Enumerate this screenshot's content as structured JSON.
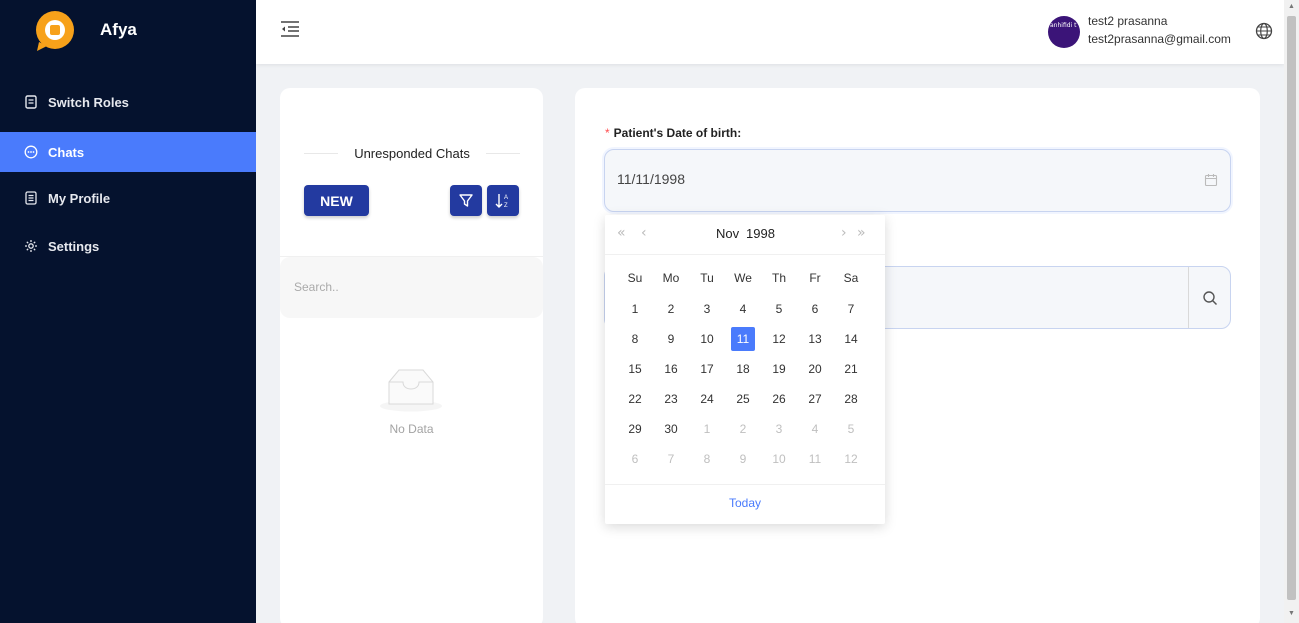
{
  "brand": {
    "name": "Afya",
    "color": "#f7a11a"
  },
  "sidebar": {
    "items": [
      {
        "label": "Switch Roles",
        "icon": "switch-roles-icon",
        "active": false
      },
      {
        "label": "Chats",
        "icon": "chat-bubble-icon",
        "active": true
      },
      {
        "label": "My Profile",
        "icon": "profile-icon",
        "active": false
      },
      {
        "label": "Settings",
        "icon": "gear-icon",
        "active": false
      }
    ]
  },
  "header": {
    "user_name": "test2  prasanna",
    "user_email": "test2prasanna@gmail.com",
    "avatar_text": "anhifidi t"
  },
  "chats": {
    "title": "Unresponded Chats",
    "new_label": "NEW",
    "search_placeholder": "Search..",
    "empty_text": "No Data"
  },
  "form": {
    "dob_label": "Patient's Date of birth",
    "dob_suffix": ":",
    "dob_value": "11/11/1998"
  },
  "datepicker": {
    "month": "Nov",
    "year": "1998",
    "weekdays": [
      "Su",
      "Mo",
      "Tu",
      "We",
      "Th",
      "Fr",
      "Sa"
    ],
    "weeks": [
      [
        "1",
        "2",
        "3",
        "4",
        "5",
        "6",
        "7"
      ],
      [
        "8",
        "9",
        "10",
        "11",
        "12",
        "13",
        "14"
      ],
      [
        "15",
        "16",
        "17",
        "18",
        "19",
        "20",
        "21"
      ],
      [
        "22",
        "23",
        "24",
        "25",
        "26",
        "27",
        "28"
      ],
      [
        "29",
        "30",
        "1",
        "2",
        "3",
        "4",
        "5"
      ],
      [
        "6",
        "7",
        "8",
        "9",
        "10",
        "11",
        "12"
      ]
    ],
    "selected_day": "11",
    "today_label": "Today",
    "accent": "#4a7bfc"
  }
}
